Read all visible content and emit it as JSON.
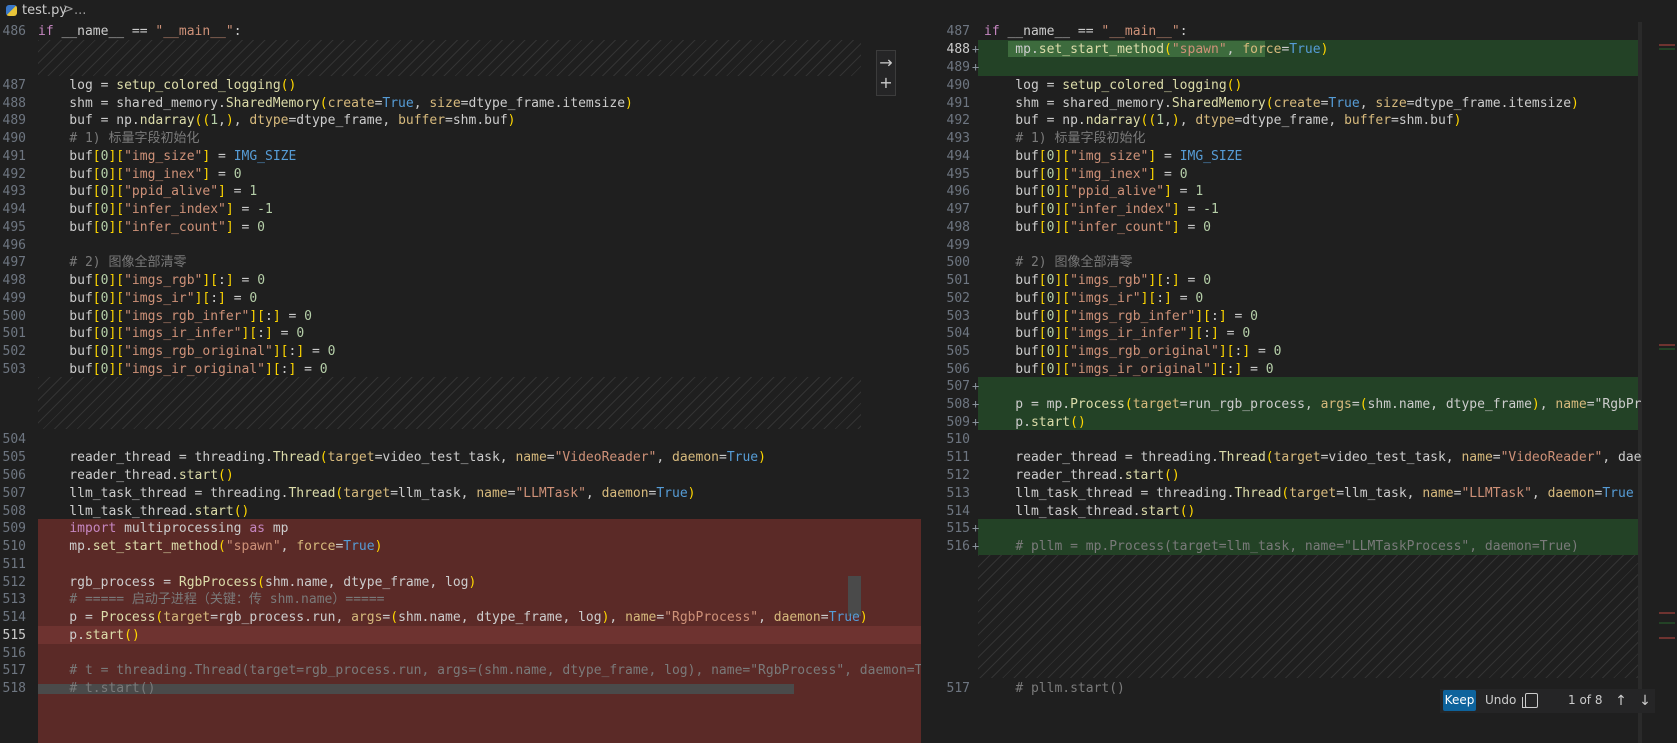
{
  "breadcrumb": {
    "file": "test.py",
    "separator": ">",
    "more": "..."
  },
  "colors": {
    "deleted": "#5b2a27",
    "added": "#234226",
    "keep_button": "#0e639c"
  },
  "left": [
    {
      "n": "486",
      "t": "if __name__ == \"__main__\":"
    },
    {
      "n": "487",
      "t": "    log = setup_colored_logging()"
    },
    {
      "n": "488",
      "t": "    shm = shared_memory.SharedMemory(create=True, size=dtype_frame.itemsize)"
    },
    {
      "n": "489",
      "t": "    buf = np.ndarray((1,), dtype=dtype_frame, buffer=shm.buf)"
    },
    {
      "n": "490",
      "t": "    # 1) 标量字段初始化"
    },
    {
      "n": "491",
      "t": "    buf[0][\"img_size\"] = IMG_SIZE"
    },
    {
      "n": "492",
      "t": "    buf[0][\"img_inex\"] = 0"
    },
    {
      "n": "493",
      "t": "    buf[0][\"ppid_alive\"] = 1"
    },
    {
      "n": "494",
      "t": "    buf[0][\"infer_index\"] = -1"
    },
    {
      "n": "495",
      "t": "    buf[0][\"infer_count\"] = 0"
    },
    {
      "n": "496",
      "t": ""
    },
    {
      "n": "497",
      "t": "    # 2) 图像全部清零"
    },
    {
      "n": "498",
      "t": "    buf[0][\"imgs_rgb\"][:] = 0"
    },
    {
      "n": "499",
      "t": "    buf[0][\"imgs_ir\"][:] = 0"
    },
    {
      "n": "500",
      "t": "    buf[0][\"imgs_rgb_infer\"][:] = 0"
    },
    {
      "n": "501",
      "t": "    buf[0][\"imgs_ir_infer\"][:] = 0"
    },
    {
      "n": "502",
      "t": "    buf[0][\"imgs_rgb_original\"][:] = 0"
    },
    {
      "n": "503",
      "t": "    buf[0][\"imgs_ir_original\"][:] = 0"
    },
    {
      "n": "504",
      "t": ""
    },
    {
      "n": "505",
      "t": "    reader_thread = threading.Thread(target=video_test_task, name=\"VideoReader\", daemon=True)"
    },
    {
      "n": "506",
      "t": "    reader_thread.start()"
    },
    {
      "n": "507",
      "t": "    llm_task_thread = threading.Thread(target=llm_task, name=\"LLMTask\", daemon=True)"
    },
    {
      "n": "508",
      "t": "    llm_task_thread.start()"
    },
    {
      "n": "509",
      "t": "    import multiprocessing as mp"
    },
    {
      "n": "510",
      "t": "    mp.set_start_method(\"spawn\", force=True)"
    },
    {
      "n": "511",
      "t": ""
    },
    {
      "n": "512",
      "t": "    rgb_process = RgbProcess(shm.name, dtype_frame, log)"
    },
    {
      "n": "513",
      "t": "    # ===== 启动子进程（关键：传 shm.name）====="
    },
    {
      "n": "514",
      "t": "    p = Process(target=rgb_process.run, args=(shm.name, dtype_frame, log), name=\"RgbProcess\", daemon=True)"
    },
    {
      "n": "515",
      "t": "    p.start()"
    },
    {
      "n": "516",
      "t": ""
    },
    {
      "n": "517",
      "t": "    # t = threading.Thread(target=rgb_process.run, args=(shm.name, dtype_frame, log), name=\"RgbProcess\", daemon=True)"
    },
    {
      "n": "518",
      "t": "    # t.start()"
    }
  ],
  "right": [
    {
      "n": "487",
      "t": "if __name__ == \"__main__\":"
    },
    {
      "n": "488",
      "t": "    mp.set_start_method(\"spawn\", force=True)"
    },
    {
      "n": "489",
      "t": ""
    },
    {
      "n": "490",
      "t": "    log = setup_colored_logging()"
    },
    {
      "n": "491",
      "t": "    shm = shared_memory.SharedMemory(create=True, size=dtype_frame.itemsize)"
    },
    {
      "n": "492",
      "t": "    buf = np.ndarray((1,), dtype=dtype_frame, buffer=shm.buf)"
    },
    {
      "n": "493",
      "t": "    # 1) 标量字段初始化"
    },
    {
      "n": "494",
      "t": "    buf[0][\"img_size\"] = IMG_SIZE"
    },
    {
      "n": "495",
      "t": "    buf[0][\"img_inex\"] = 0"
    },
    {
      "n": "496",
      "t": "    buf[0][\"ppid_alive\"] = 1"
    },
    {
      "n": "497",
      "t": "    buf[0][\"infer_index\"] = -1"
    },
    {
      "n": "498",
      "t": "    buf[0][\"infer_count\"] = 0"
    },
    {
      "n": "499",
      "t": ""
    },
    {
      "n": "500",
      "t": "    # 2) 图像全部清零"
    },
    {
      "n": "501",
      "t": "    buf[0][\"imgs_rgb\"][:] = 0"
    },
    {
      "n": "502",
      "t": "    buf[0][\"imgs_ir\"][:] = 0"
    },
    {
      "n": "503",
      "t": "    buf[0][\"imgs_rgb_infer\"][:] = 0"
    },
    {
      "n": "504",
      "t": "    buf[0][\"imgs_ir_infer\"][:] = 0"
    },
    {
      "n": "505",
      "t": "    buf[0][\"imgs_rgb_original\"][:] = 0"
    },
    {
      "n": "506",
      "t": "    buf[0][\"imgs_ir_original\"][:] = 0"
    },
    {
      "n": "507",
      "t": ""
    },
    {
      "n": "508",
      "t": "    p = mp.Process(target=run_rgb_process, args=(shm.name, dtype_frame), name=\"RgbPr"
    },
    {
      "n": "509",
      "t": "    p.start()"
    },
    {
      "n": "510",
      "t": ""
    },
    {
      "n": "511",
      "t": "    reader_thread = threading.Thread(target=video_test_task, name=\"VideoReader\", dae"
    },
    {
      "n": "512",
      "t": "    reader_thread.start()"
    },
    {
      "n": "513",
      "t": "    llm_task_thread = threading.Thread(target=llm_task, name=\"LLMTask\", daemon=True"
    },
    {
      "n": "514",
      "t": "    llm_task_thread.start()"
    },
    {
      "n": "515",
      "t": ""
    },
    {
      "n": "516",
      "t": "    # pllm = mp.Process(target=llm_task, name=\"LLMTaskProcess\", daemon=True)"
    },
    {
      "n": "517",
      "t": "    # pllm.start()"
    }
  ],
  "toolbar": {
    "keep": "Keep",
    "undo": "Undo",
    "count": "1 of 8"
  }
}
